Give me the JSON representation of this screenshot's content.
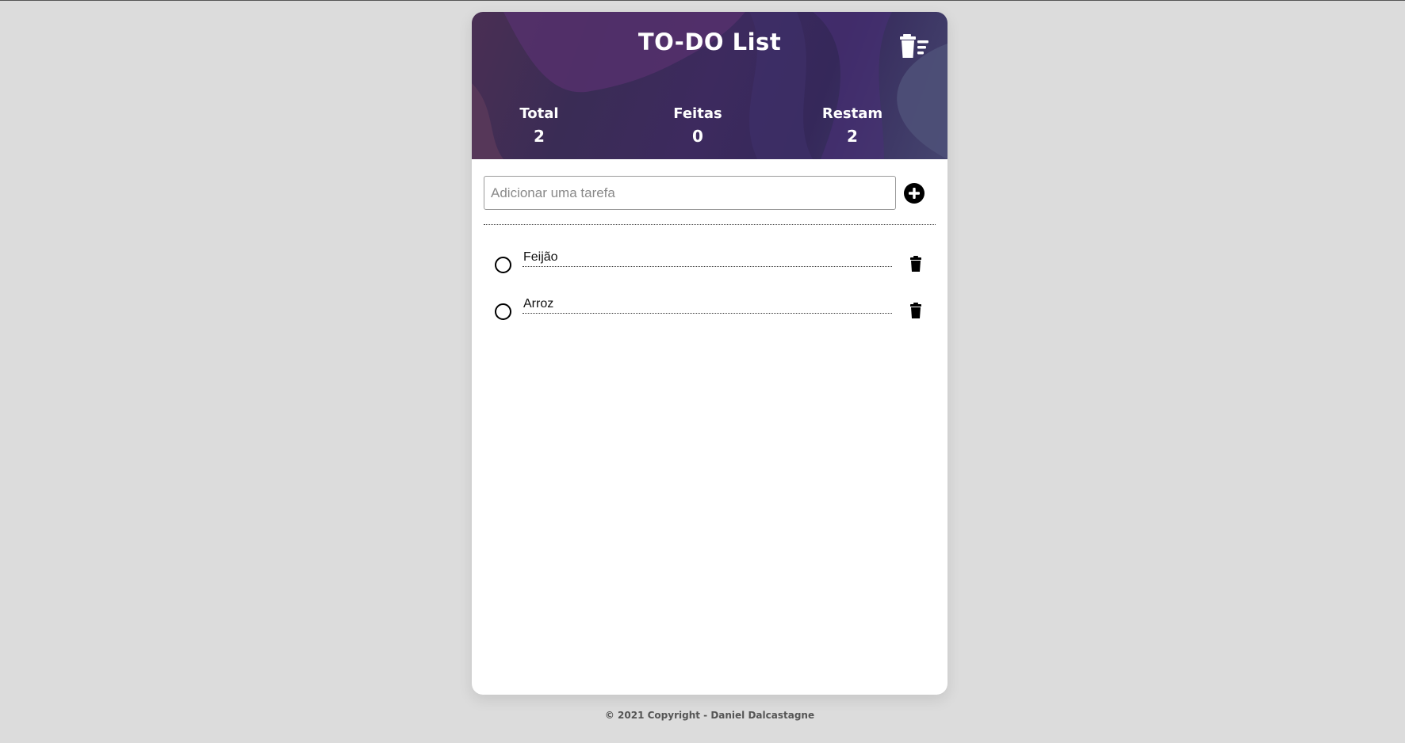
{
  "header": {
    "title": "TO-DO List",
    "clear_all_icon": "trash-list-icon",
    "colors": {
      "gradient_start": "#4a2f54",
      "gradient_end": "#45456f"
    }
  },
  "stats": {
    "total_label": "Total",
    "total_value": "2",
    "done_label": "Feitas",
    "done_value": "0",
    "remaining_label": "Restam",
    "remaining_value": "2"
  },
  "add": {
    "placeholder": "Adicionar uma tarefa",
    "value": "",
    "add_icon": "plus-circle-icon"
  },
  "tasks": [
    {
      "text": "Feijão",
      "done": false
    },
    {
      "text": "Arroz",
      "done": false
    }
  ],
  "footer": {
    "text": "© 2021 Copyright - Daniel Dalcastagne"
  }
}
